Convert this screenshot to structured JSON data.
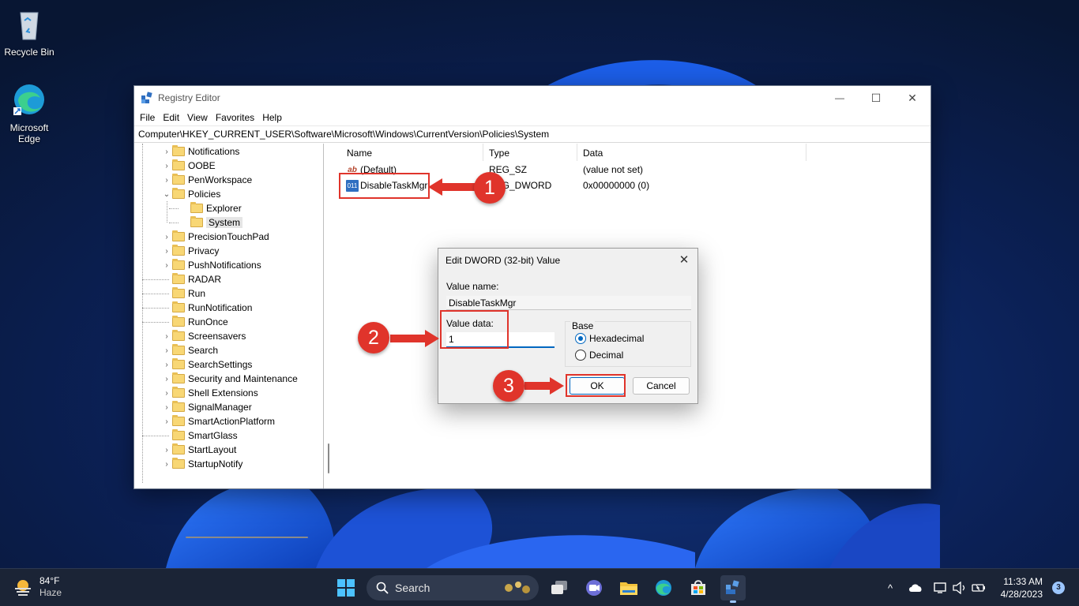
{
  "desktop": {
    "icons": [
      {
        "label": "Recycle Bin"
      },
      {
        "label_line1": "Microsoft",
        "label_line2": "Edge"
      }
    ]
  },
  "window": {
    "title": "Registry Editor",
    "controls": {
      "minimize": "—",
      "maximize": "☐",
      "close": "✕"
    },
    "menu": [
      "File",
      "Edit",
      "View",
      "Favorites",
      "Help"
    ],
    "address": "Computer\\HKEY_CURRENT_USER\\Software\\Microsoft\\Windows\\CurrentVersion\\Policies\\System",
    "tree": [
      {
        "label": "Notifications",
        "expander": "›"
      },
      {
        "label": "OOBE",
        "expander": "›"
      },
      {
        "label": "PenWorkspace",
        "expander": "›"
      },
      {
        "label": "Policies",
        "expander": "⌄"
      },
      {
        "label": "Explorer",
        "expander": ""
      },
      {
        "label": "System",
        "expander": "",
        "selected": true
      },
      {
        "label": "PrecisionTouchPad",
        "expander": "›"
      },
      {
        "label": "Privacy",
        "expander": "›"
      },
      {
        "label": "PushNotifications",
        "expander": "›"
      },
      {
        "label": "RADAR",
        "expander": ""
      },
      {
        "label": "Run",
        "expander": ""
      },
      {
        "label": "RunNotification",
        "expander": ""
      },
      {
        "label": "RunOnce",
        "expander": ""
      },
      {
        "label": "Screensavers",
        "expander": "›"
      },
      {
        "label": "Search",
        "expander": "›"
      },
      {
        "label": "SearchSettings",
        "expander": "›"
      },
      {
        "label": "Security and Maintenance",
        "expander": "›"
      },
      {
        "label": "Shell Extensions",
        "expander": "›"
      },
      {
        "label": "SignalManager",
        "expander": "›"
      },
      {
        "label": "SmartActionPlatform",
        "expander": "›"
      },
      {
        "label": "SmartGlass",
        "expander": ""
      },
      {
        "label": "StartLayout",
        "expander": "›"
      },
      {
        "label": "StartupNotify",
        "expander": "›"
      }
    ],
    "columns": {
      "name": "Name",
      "type": "Type",
      "data": "Data"
    },
    "values": [
      {
        "icon": "ab",
        "name": "(Default)",
        "type": "REG_SZ",
        "data": "(value not set)"
      },
      {
        "icon": "011",
        "name": "DisableTaskMgr",
        "type": "REG_DWORD",
        "data": "0x00000000 (0)"
      }
    ]
  },
  "dialog": {
    "title": "Edit DWORD (32-bit) Value",
    "close": "✕",
    "value_name_label": "Value name:",
    "value_name": "DisableTaskMgr",
    "value_data_label": "Value data:",
    "value_data": "1",
    "base_label": "Base",
    "base_options": [
      {
        "label": "Hexadecimal",
        "selected": true
      },
      {
        "label": "Decimal",
        "selected": false
      }
    ],
    "ok": "OK",
    "cancel": "Cancel"
  },
  "annotations": {
    "steps": [
      "1",
      "2",
      "3"
    ],
    "color": "#e0342b"
  },
  "taskbar": {
    "weather": {
      "temp": "84°F",
      "condition": "Haze"
    },
    "search_label": "Search",
    "apps": [
      "start-icon",
      "task-view-icon",
      "teams-chat-icon",
      "file-explorer-icon",
      "edge-icon",
      "store-icon",
      "registry-editor-icon"
    ],
    "tray": {
      "chevron": "^"
    },
    "clock": {
      "time": "11:33 AM",
      "date": "4/28/2023"
    },
    "notification_count": "3"
  }
}
